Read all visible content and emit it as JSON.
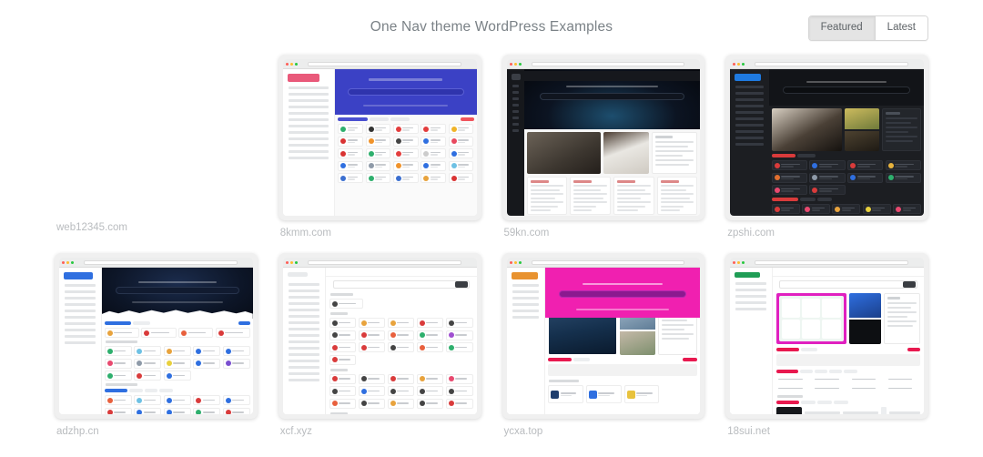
{
  "header": {
    "title": "One Nav theme WordPress Examples",
    "toggle": {
      "featured_label": "Featured",
      "latest_label": "Latest",
      "active": "Featured"
    }
  },
  "grid": {
    "columns": 4,
    "items": [
      {
        "label": "web12345.com",
        "has_thumbnail": false,
        "theme": "none",
        "description": "Missing or unloaded preview image"
      },
      {
        "label": "8kmm.com",
        "has_thumbnail": true,
        "theme": "light",
        "hero_color": "#3b41c5",
        "sidebar": "light",
        "layout": "hero-search-grid",
        "description": "Blue hero banner with search, light sidebar, grid of link tiles"
      },
      {
        "label": "59kn.com",
        "has_thumbnail": true,
        "theme": "dark",
        "hero_color": "#0b0f18",
        "sidebar": "darker",
        "layout": "dark-hero-photos-articles",
        "description": "Dark starfield hero, photo cards, four article list columns"
      },
      {
        "label": "zpshi.com",
        "has_thumbnail": true,
        "theme": "dark",
        "hero_color": "#121418",
        "sidebar": "dark",
        "layout": "dark-hero-photo-tiles",
        "accent": "#1f7ae0",
        "description": "Dark nav site, blue logo, photo hero, red tag chips, link tiles"
      },
      {
        "label": "adzhp.cn",
        "has_thumbnail": true,
        "theme": "light",
        "hero_color": "#0d1628",
        "sidebar": "light",
        "layout": "night-hero-wave-grid",
        "accent": "#2f6fe0",
        "description": "Dark starry hero with white wave edge, light sidebar, link tiles"
      },
      {
        "label": "xcf.xyz",
        "has_thumbnail": true,
        "theme": "light",
        "hero_color": "#ffffff",
        "sidebar": "light",
        "layout": "clean-search-dense-grid",
        "description": "Clean white layout with search field and dense link tile grid"
      },
      {
        "label": "ycxa.top",
        "has_thumbnail": true,
        "theme": "light",
        "hero_color": "#f020b0",
        "sidebar": "light",
        "layout": "magenta-hero-photos",
        "accent": "#e8197f",
        "description": "Magenta hero banner, property photo cards, red chips, link tiles"
      },
      {
        "label": "18sui.net",
        "has_thumbnail": true,
        "theme": "light",
        "hero_color": "#ffffff",
        "sidebar": "light",
        "layout": "banner-cards-list",
        "accent": "#1f9d55",
        "description": "Light layout with colorful promo banner cards and link rows"
      }
    ]
  }
}
